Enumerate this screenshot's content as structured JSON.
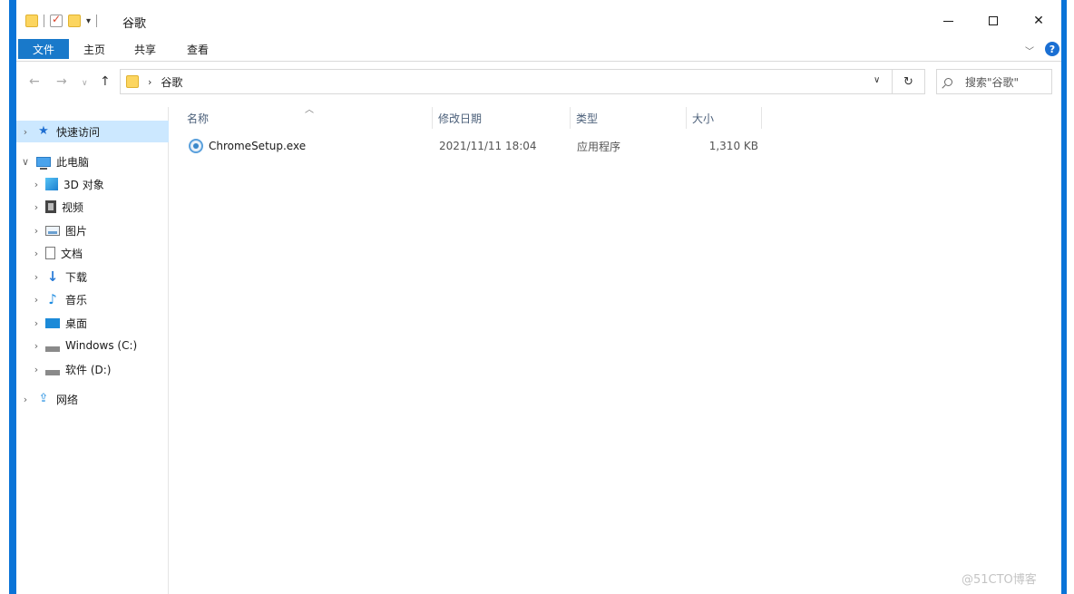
{
  "window": {
    "title": "谷歌",
    "accent": "#0a74d8"
  },
  "ribbon": {
    "tabs": [
      "文件",
      "主页",
      "共享",
      "查看"
    ],
    "help_label": "?"
  },
  "address": {
    "path": "谷歌",
    "search_placeholder": "搜索\"谷歌\""
  },
  "nav": {
    "quick_access": "快速访问",
    "this_pc": "此电脑",
    "items": [
      "3D 对象",
      "视频",
      "图片",
      "文档",
      "下载",
      "音乐",
      "桌面",
      "Windows (C:)",
      "软件 (D:)"
    ],
    "network": "网络"
  },
  "columns": {
    "name": "名称",
    "date": "修改日期",
    "type": "类型",
    "size": "大小"
  },
  "files": [
    {
      "name": "ChromeSetup.exe",
      "date": "2021/11/11 18:04",
      "type": "应用程序",
      "size": "1,310 KB"
    }
  ],
  "watermark": "@51CTO博客"
}
